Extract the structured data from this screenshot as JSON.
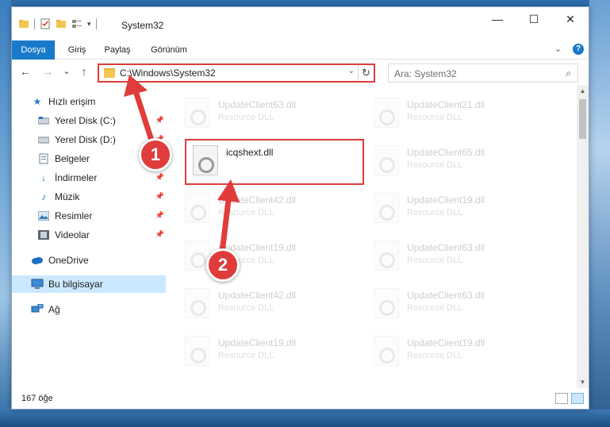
{
  "window": {
    "title": "System32",
    "controls": {
      "minimize": "—",
      "maximize": "☐",
      "close": "✕"
    }
  },
  "ribbon": {
    "tabs": [
      {
        "label": "Dosya"
      },
      {
        "label": "Giriş"
      },
      {
        "label": "Paylaş"
      },
      {
        "label": "Görünüm"
      }
    ],
    "expand_icon": "chevron-down",
    "help": "?"
  },
  "navbar": {
    "back": "←",
    "forward": "→",
    "recent": "⌄",
    "up": "↑",
    "address": "C:\\Windows\\System32",
    "search_placeholder": "Ara: System32"
  },
  "sidebar": {
    "items": [
      {
        "label": "Hızlı erişim",
        "icon": "star-icon"
      },
      {
        "label": "Yerel Disk (C:)",
        "icon": "drive-icon",
        "pinned": true
      },
      {
        "label": "Yerel Disk (D:)",
        "icon": "drive-icon",
        "pinned": true
      },
      {
        "label": "Belgeler",
        "icon": "documents-icon",
        "pinned": true
      },
      {
        "label": "İndirmeler",
        "icon": "download-icon",
        "pinned": true
      },
      {
        "label": "Müzik",
        "icon": "music-icon",
        "pinned": true
      },
      {
        "label": "Resimler",
        "icon": "pictures-icon",
        "pinned": true
      },
      {
        "label": "Videolar",
        "icon": "videos-icon",
        "pinned": true
      },
      {
        "label": "OneDrive",
        "icon": "cloud-icon"
      },
      {
        "label": "Bu bilgisayar",
        "icon": "computer-icon",
        "selected": true
      },
      {
        "label": "Ağ",
        "icon": "network-icon"
      }
    ]
  },
  "files": {
    "highlighted": {
      "name": "icqshext.dll"
    },
    "ghost": [
      {
        "name": "UpdateClient63.dll",
        "desc": "Resource DLL"
      },
      {
        "name": "UpdateClient21.dll",
        "desc": "Resource DLL"
      },
      {
        "name": "UpdateClient65.dll",
        "desc": "Resource DLL"
      },
      {
        "name": "UpdateClient42.dll",
        "desc": "Resource DLL"
      },
      {
        "name": "UpdateClient19.dll",
        "desc": "Resource DLL"
      },
      {
        "name": "UpdateClient19.dll",
        "desc": "Resource DLL"
      },
      {
        "name": "UpdateClient63.dll",
        "desc": "Resource DLL"
      },
      {
        "name": "UpdateClient42.dll",
        "desc": "Resource DLL"
      },
      {
        "name": "UpdateClient63.dll",
        "desc": "Resource DLL"
      },
      {
        "name": "UpdateClient19.dll",
        "desc": "Resource DLL"
      },
      {
        "name": "UpdateClient19.dll",
        "desc": "Resource DLL"
      }
    ]
  },
  "status": {
    "item_count": "167 öğe"
  },
  "annotations": {
    "step1": "1",
    "step2": "2",
    "color": "#e03c3c"
  }
}
